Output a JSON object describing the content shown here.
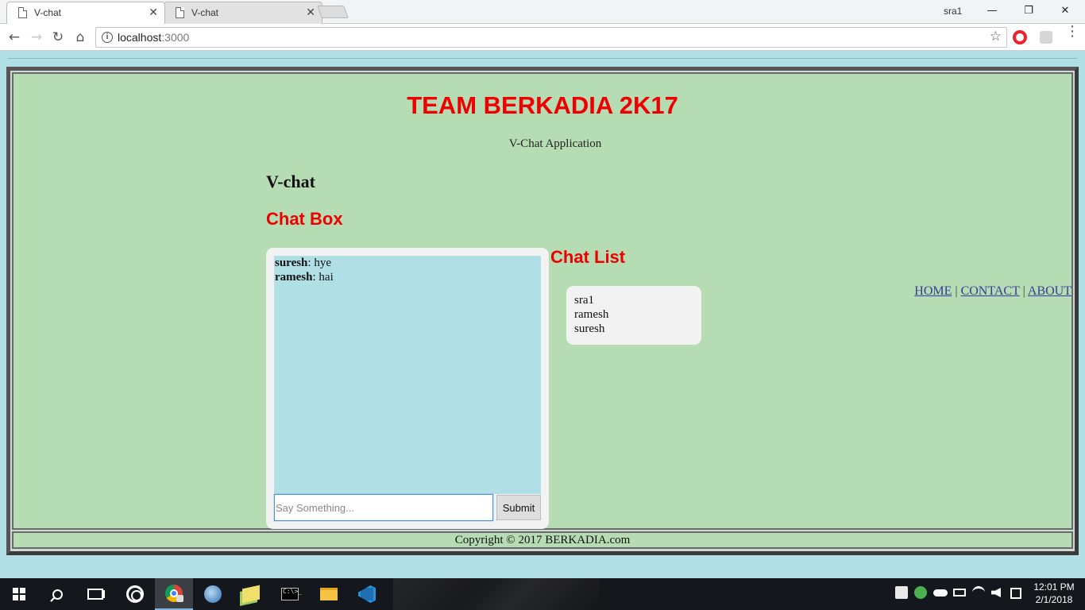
{
  "browser": {
    "tabs": [
      {
        "title": "V-chat",
        "close": "✕"
      },
      {
        "title": "V-chat",
        "close": "✕"
      }
    ],
    "profile_name": "sra1",
    "window_controls": {
      "minimize": "—",
      "restore": "❐",
      "close": "✕"
    },
    "nav": {
      "back": "←",
      "forward": "→",
      "reload": "↻",
      "home": "⌂"
    },
    "address": {
      "host": "localhost",
      "port": ":3000",
      "info": "i",
      "bookmark": "☆"
    },
    "menu": "⋮"
  },
  "page": {
    "site_title": "TEAM BERKADIA 2K17",
    "subtitle": "V-Chat Application",
    "app_name": "V-chat",
    "chat_box_heading": "Chat Box",
    "chat_list_heading": "Chat List",
    "messages": [
      {
        "user": "suresh",
        "text": ": hye"
      },
      {
        "user": "ramesh",
        "text": ": hai"
      }
    ],
    "input": {
      "placeholder": "Say Something...",
      "value": ""
    },
    "submit_label": "Submit",
    "users": [
      "sra1",
      "ramesh",
      "suresh"
    ],
    "nav_links": {
      "home": "HOME",
      "separator": " | ",
      "contact": "CONTACT",
      "about": "ABOUT"
    },
    "footer": "Copyright © 2017 BERKADIA.com"
  },
  "taskbar": {
    "time": "12:01 PM",
    "date": "2/1/2018",
    "cmd_text": "C:\\>_",
    "apps": [
      "start-icon",
      "search-icon",
      "task-view-icon",
      "cortana-icon",
      "chrome-icon",
      "thunderbird-icon",
      "sticky-notes-icon",
      "cmd-icon",
      "file-explorer-icon",
      "vscode-icon"
    ]
  }
}
